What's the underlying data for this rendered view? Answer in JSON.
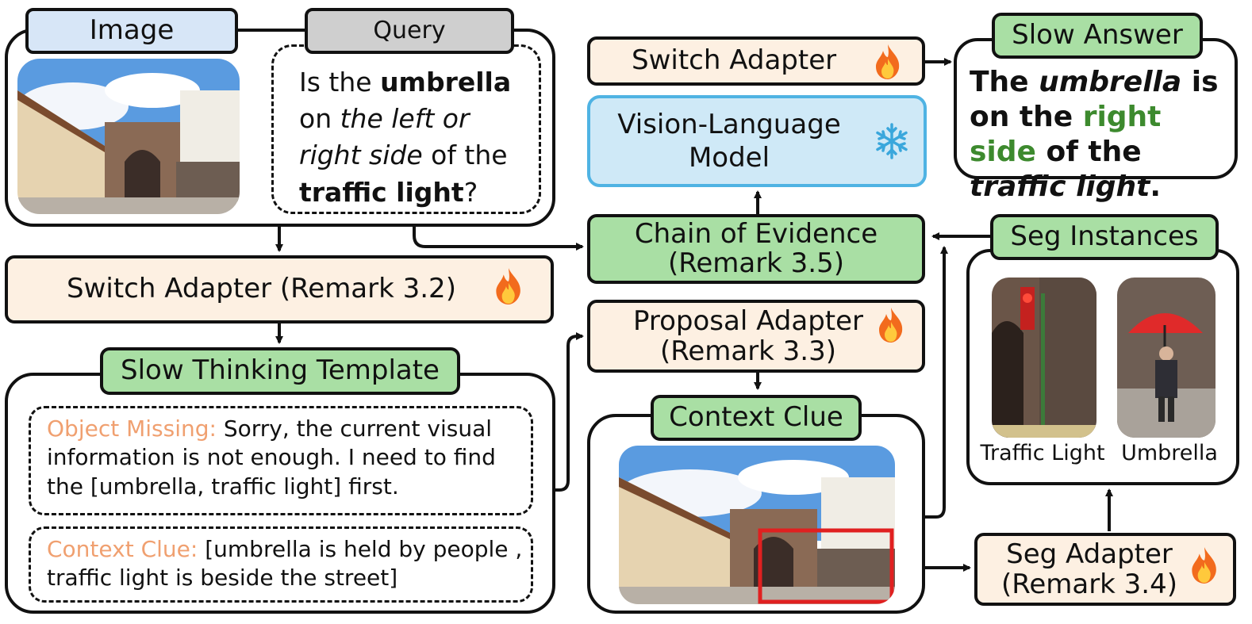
{
  "image_tag": "Image",
  "query_tag": "Query",
  "query": {
    "p1": "Is the ",
    "b1": "umbrella",
    "p2": " on ",
    "i1": "the left or right side",
    "p3": " of the ",
    "b2": "traffic light",
    "p4": "?"
  },
  "switch_adapter_left": "Switch Adapter  (Remark 3.2)",
  "slow_thinking_template": "Slow Thinking Template",
  "object_missing": {
    "label": "Object Missing:",
    "text": " Sorry, the current visual information is not enough. I need to find the  [umbrella, traffic light] first."
  },
  "context_clue_entry": {
    "label": "Context Clue:",
    "text": " [umbrella is held by people , traffic light is beside the street]"
  },
  "switch_adapter_top": "Switch Adapter",
  "vlm": {
    "line1": "Vision-Language",
    "line2": "Model"
  },
  "chain_of_evidence": {
    "line1": "Chain of Evidence",
    "line2": "(Remark 3.5)"
  },
  "proposal_adapter": {
    "line1": "Proposal Adapter",
    "line2": "(Remark 3.3)"
  },
  "context_clue_tag": "Context Clue",
  "slow_answer_tag": "Slow Answer",
  "slow_answer": {
    "p1": "The ",
    "i1": "umbrella",
    "p2": " is on the ",
    "g1": "right side",
    "p3": " of the ",
    "i2": "traffic light",
    "p4": "."
  },
  "seg_instances_tag": "Seg Instances",
  "instance_labels": {
    "traffic_light": "Traffic Light",
    "umbrella": "Umbrella"
  },
  "seg_adapter": {
    "line1": "Seg Adapter",
    "line2": "(Remark 3.4)"
  },
  "icons": {
    "trainable": "flame-icon",
    "frozen": "snowflake-icon"
  },
  "colors": {
    "green_box": "#a9dfa4",
    "peach_box": "#fdf0e2",
    "blue_box": "#d7e6f7",
    "vlm_border": "#4fb3e3",
    "highlight": "#e02020",
    "label_orange": "#f0a070",
    "answer_green": "#3d8a2e"
  }
}
